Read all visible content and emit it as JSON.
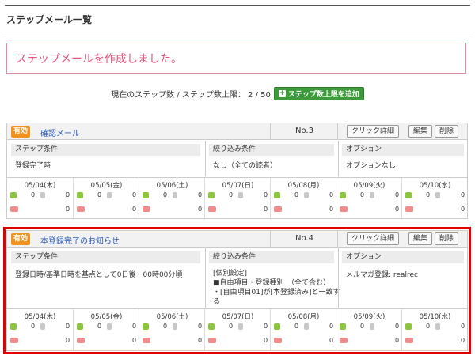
{
  "page": {
    "title": "ステップメール一覧"
  },
  "message": "ステップメールを作成しました。",
  "count": {
    "text": "現在のステップ数 / ステップ数上限： 2 / 50",
    "add_button": "ステップ数上限を追加"
  },
  "labels": {
    "click_detail": "クリック詳細",
    "edit": "編集",
    "delete": "削除",
    "step_condition": "ステップ条件",
    "filter_condition": "絞り込み条件",
    "option": "オプション"
  },
  "mails": [
    {
      "badge": "有効",
      "name": "確認メール",
      "no": "No.3",
      "step_condition": "登録完了時",
      "filter_lines": [
        "なし（全ての読者）"
      ],
      "option": "オプションなし",
      "days": [
        {
          "date": "05/04(木)",
          "sent": "0",
          "removed": "0",
          "errors": "0"
        },
        {
          "date": "05/05(金)",
          "sent": "0",
          "removed": "0",
          "errors": "0"
        },
        {
          "date": "05/06(土)",
          "sent": "0",
          "removed": "0",
          "errors": "0"
        },
        {
          "date": "05/07(日)",
          "sent": "0",
          "removed": "0",
          "errors": "0"
        },
        {
          "date": "05/08(月)",
          "sent": "0",
          "removed": "0",
          "errors": "0"
        },
        {
          "date": "05/09(火)",
          "sent": "0",
          "removed": "0",
          "errors": "0"
        },
        {
          "date": "05/10(水)",
          "sent": "0",
          "removed": "0",
          "errors": "0"
        }
      ]
    },
    {
      "badge": "有効",
      "name": "本登録完了のお知らせ",
      "no": "No.4",
      "step_condition": "登録日時/基準日時を基点として0日後　00時00分頃",
      "filter_lines": [
        "[個別設定]",
        "■自由項目・登録種別　（全て含む）",
        "・[自由項目01]が[本登録済み]と一致す",
        "る"
      ],
      "option": "メルマガ登録: realrec",
      "days": [
        {
          "date": "05/04(木)",
          "sent": "0",
          "removed": "0",
          "errors": "0"
        },
        {
          "date": "05/05(金)",
          "sent": "0",
          "removed": "0",
          "errors": "0"
        },
        {
          "date": "05/06(土)",
          "sent": "0",
          "removed": "0",
          "errors": "0"
        },
        {
          "date": "05/07(日)",
          "sent": "0",
          "removed": "0",
          "errors": "0"
        },
        {
          "date": "05/08(月)",
          "sent": "0",
          "removed": "0",
          "errors": "0"
        },
        {
          "date": "05/09(火)",
          "sent": "0",
          "removed": "0",
          "errors": "0"
        },
        {
          "date": "05/10(水)",
          "sent": "0",
          "removed": "0",
          "errors": "0"
        }
      ]
    }
  ],
  "highlight": {
    "selected_mail_index": 1,
    "outline_color": "#e00000"
  }
}
